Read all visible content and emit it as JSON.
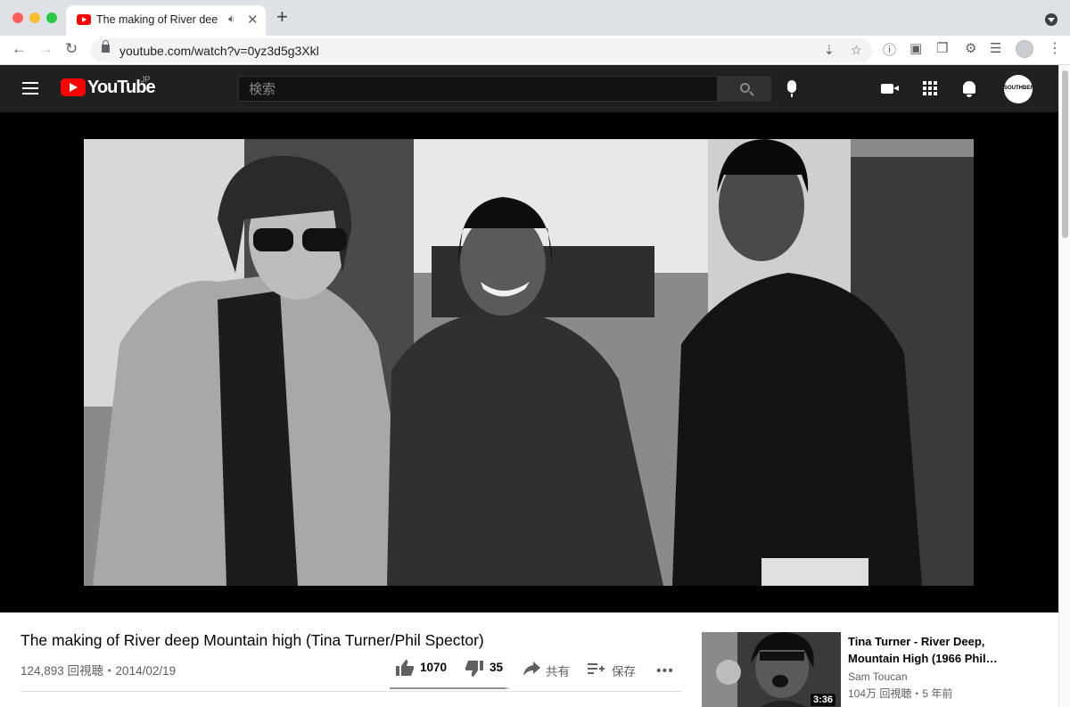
{
  "browser": {
    "tab_title": "The making of River deep Mountain high",
    "tab_audio_icon": "speaker-icon",
    "url": "youtube.com/watch?v=0yz3d5g3Xkl"
  },
  "masthead": {
    "logo_text": "YouTube",
    "region": "JP",
    "search_placeholder": "検索",
    "avatar_text": "SOUTHBERRY"
  },
  "video": {
    "title": "The making of River deep Mountain high (Tina Turner/Phil Spector)",
    "meta": "124,893 回視聴・2014/02/19",
    "likes": "1070",
    "dislikes": "35",
    "share_label": "共有",
    "save_label": "保存",
    "like_ratio": 0.968
  },
  "recommendation": {
    "title": "Tina Turner - River Deep, Mountain High (1966 Phil…",
    "channel": "Sam Toucan",
    "stats": "104万 回視聴・5 年前",
    "duration": "3:36"
  },
  "colors": {
    "brand_red": "#ff0000",
    "masthead_bg": "#202020",
    "player_bg": "#000000"
  }
}
